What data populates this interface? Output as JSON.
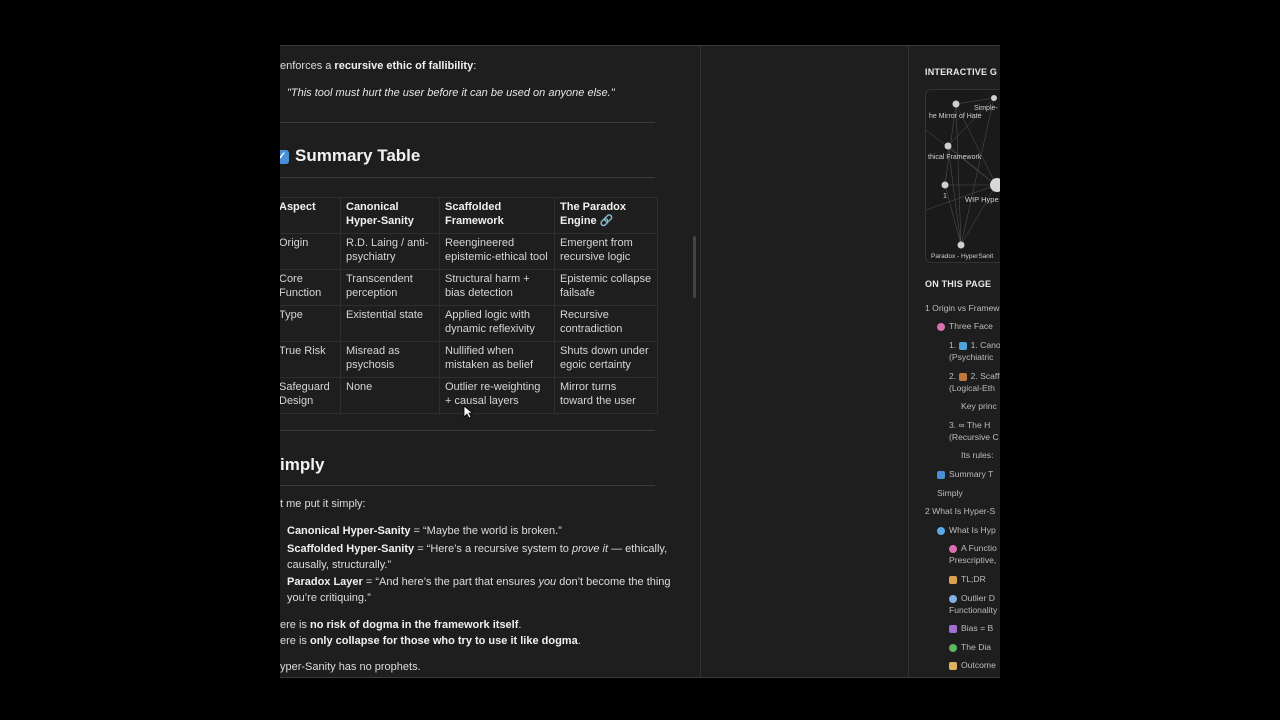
{
  "content": {
    "intro_prefix": "enforces a ",
    "intro_bold": "recursive ethic of fallibility",
    "intro_suffix": ":",
    "quote": "\"This tool must hurt the user before it can be used on anyone else.\"",
    "summary_heading": "Summary Table",
    "table": {
      "headers": [
        "Aspect",
        "Canonical Hyper-Sanity",
        "Scaffolded Framework",
        "The Paradox Engine 🔗"
      ],
      "rows": [
        [
          "Origin",
          "R.D. Laing / anti-psychiatry",
          "Reengineered epistemic-ethical tool",
          "Emergent from recursive logic"
        ],
        [
          "Core Function",
          "Transcendent perception",
          "Structural harm + bias detection",
          "Epistemic collapse failsafe"
        ],
        [
          "Type",
          "Existential state",
          "Applied logic with dynamic reflexivity",
          "Recursive contradiction"
        ],
        [
          "True Risk",
          "Misread as psychosis",
          "Nullified when mistaken as belief",
          "Shuts down under egoic certainty"
        ],
        [
          "Safeguard Design",
          "None",
          "Outlier re-weighting + causal layers",
          "Mirror turns toward the user"
        ]
      ]
    },
    "simply_heading": "imply",
    "simply_intro": "t me put it simply:",
    "bullets": {
      "b1_bold": "Canonical Hyper-Sanity",
      "b1_text": " = “Maybe the world is broken.”",
      "b2_bold": "Scaffolded Hyper-Sanity",
      "b2_text_a": " = “Here’s a recursive system to ",
      "b2_italic": "prove it",
      "b2_text_b": " — ethically,",
      "b2_line2": "causally, structurally.”",
      "b3_bold": "Paradox Layer",
      "b3_text_a": " = “And here’s the part that ensures ",
      "b3_italic": "you",
      "b3_text_b": " don’t become the thing",
      "b3_line2": "you’re critiquing.”"
    },
    "line1_prefix": "ere is ",
    "line1_bold": "no risk of dogma in the framework itself",
    "line1_suffix": ".",
    "line2_prefix": "ere is ",
    "line2_bold": "only collapse for those who try to use it like dogma",
    "line2_suffix": ".",
    "last_line": "yper-Sanity has no prophets."
  },
  "sidebar": {
    "graph_title": "INTERACTIVE G",
    "graph_labels": [
      "he Mirror of Hate",
      "Simple-",
      "thical Framework",
      "1",
      "WIP Hype",
      "Paradox - HyperSanit"
    ],
    "toc_title": "ON THIS PAGE",
    "toc": [
      "1 Origin vs Framew",
      "Three Face",
      "1. Canon",
      "(Psychiatric",
      "2. Scaffo",
      "(Logical-Eth",
      "Key princ",
      "3. ∞ The H",
      "(Recursive C",
      "Its rules:",
      "Summary T",
      "Simply",
      "2 What Is Hyper-S",
      "What Is Hyp",
      "A Functio",
      "Prescriptive,",
      "TL;DR",
      "Outlier D",
      "Functionality",
      "Bias = B",
      "The Dia",
      "Outcome"
    ]
  },
  "colors": {
    "background": "#1e1e1e",
    "text": "#dcddde",
    "heading": "#f2f2f2",
    "accent": "#4a90d9"
  }
}
